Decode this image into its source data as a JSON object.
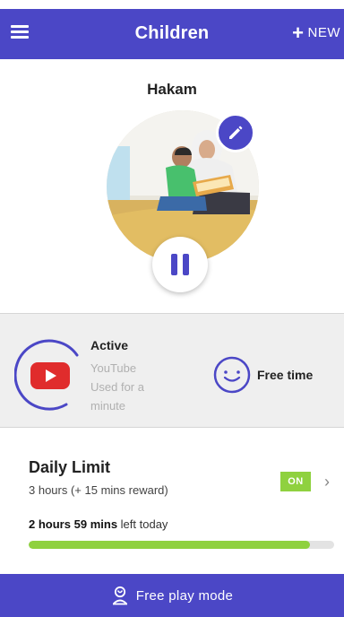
{
  "header": {
    "title": "Children",
    "new_label": "NEW",
    "bg_color": "#4b47c6"
  },
  "profile": {
    "child_name": "Hakam",
    "avatar": "child-photo",
    "edit_icon": "pencil-icon",
    "pause_icon": "pause-icon"
  },
  "activity": {
    "status": "Active",
    "app_name": "YouTube",
    "used_text": "Used for a minute",
    "app_icon": "youtube-icon",
    "free_time_label": "Free time",
    "free_time_icon": "smile-icon"
  },
  "daily_limit": {
    "title": "Daily Limit",
    "detail": "3 hours (+ 15 mins reward)",
    "toggle_label": "ON",
    "hours_value": "2",
    "hours_word": "hours",
    "mins_value": "59",
    "mins_word": "mins",
    "left_suffix": "left today",
    "progress_percent": 92,
    "accent_color": "#8fd13f"
  },
  "footer": {
    "label": "Free play mode",
    "icon": "person-play-icon"
  }
}
